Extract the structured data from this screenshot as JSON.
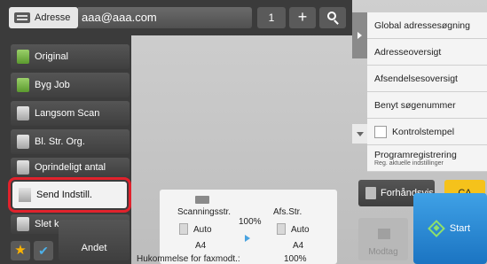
{
  "header": {
    "address_label": "Adresse",
    "address_value": "aaa@aaa.com",
    "recipient_count": "1",
    "add_label": "+"
  },
  "modes": [
    {
      "label": "Original",
      "icon": "original-icon"
    },
    {
      "label": "Byg Job",
      "icon": "build-job-icon"
    },
    {
      "label": "Langsom Scan",
      "icon": "slow-scan-icon"
    },
    {
      "label": "Bl. Str. Org.",
      "icon": "mixed-size-icon"
    },
    {
      "label": "Oprindeligt antal",
      "icon": "original-count-icon"
    },
    {
      "label": "Send Indstill.",
      "icon": "send-settings-icon"
    },
    {
      "label": "Slet kant",
      "icon": "erase-edge-icon"
    }
  ],
  "bottom_left": {
    "star_icon": "star-icon",
    "check_icon": "check-icon",
    "other_label": "Andet"
  },
  "summary": {
    "scan_size_label": "Scanningsstr.",
    "scan_size_value": "Auto",
    "scan_paper": "A4",
    "ratio": "100%",
    "send_size_label": "Afs.Str.",
    "send_size_value": "Auto",
    "send_paper": "A4",
    "memory_label": "Hukommelse for faxmodt.:",
    "memory_value": "100%"
  },
  "right_menu": [
    "Global adressesøgning",
    "Adresseoversigt",
    "Afsendelsesoversigt",
    "Benyt søgenummer"
  ],
  "control_stamp_label": "Kontrolstempel",
  "program": {
    "title": "Programregistrering",
    "subtitle": "Reg. aktuelle indstillinger"
  },
  "actions": {
    "preview_label": "Forhåndsvis",
    "ca_label": "CA",
    "modtag_label": "Modtag",
    "start_label": "Start"
  },
  "colors": {
    "highlight": "#e1222c",
    "start": "#2a8ad6",
    "ca": "#f5c21b"
  }
}
